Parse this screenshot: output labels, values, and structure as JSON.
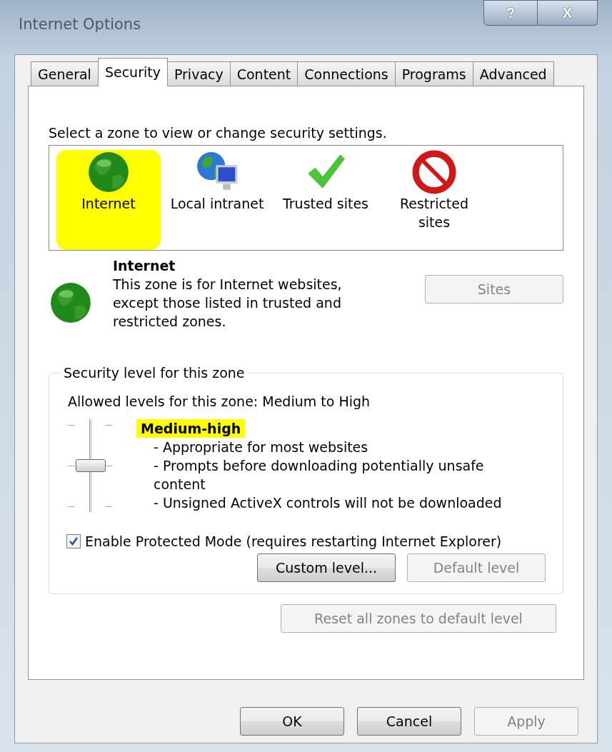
{
  "window": {
    "title": "Internet Options",
    "help": "?",
    "close": "X"
  },
  "tabs": [
    {
      "label": "General",
      "selected": false
    },
    {
      "label": "Security",
      "selected": true
    },
    {
      "label": "Privacy",
      "selected": false
    },
    {
      "label": "Content",
      "selected": false
    },
    {
      "label": "Connections",
      "selected": false
    },
    {
      "label": "Programs",
      "selected": false
    },
    {
      "label": "Advanced",
      "selected": false
    }
  ],
  "zone_prompt": "Select a zone to view or change security settings.",
  "zones": [
    {
      "kind": "internet",
      "label": "Internet",
      "selected": true
    },
    {
      "kind": "intranet",
      "label": "Local intranet",
      "selected": false
    },
    {
      "kind": "trusted",
      "label": "Trusted sites",
      "selected": false
    },
    {
      "kind": "restricted",
      "label": "Restricted sites",
      "selected": false
    }
  ],
  "zone_info": {
    "kind": "internet",
    "title": "Internet",
    "description": "This zone is for Internet websites, except those listed in trusted and restricted zones.",
    "sites_button": {
      "label": "Sites",
      "disabled": true
    }
  },
  "security_level": {
    "legend": "Security level for this zone",
    "allowed": "Allowed levels for this zone: Medium to High",
    "level": 0.5,
    "level_name": "Medium-high",
    "highlighted": true,
    "details": [
      "- Appropriate for most websites",
      "- Prompts before downloading potentially unsafe content",
      "- Unsigned ActiveX controls will not be downloaded"
    ],
    "protected_mode": {
      "label": "Enable Protected Mode (requires restarting Internet Explorer)",
      "checked": true
    },
    "buttons": [
      {
        "label": "Custom level...",
        "disabled": false
      },
      {
        "label": "Default level",
        "disabled": true
      }
    ]
  },
  "reset_button": {
    "label": "Reset all zones to default level",
    "disabled": true
  },
  "dialog_buttons": [
    {
      "label": "OK",
      "disabled": false
    },
    {
      "label": "Cancel",
      "disabled": false
    },
    {
      "label": "Apply",
      "disabled": true
    }
  ]
}
